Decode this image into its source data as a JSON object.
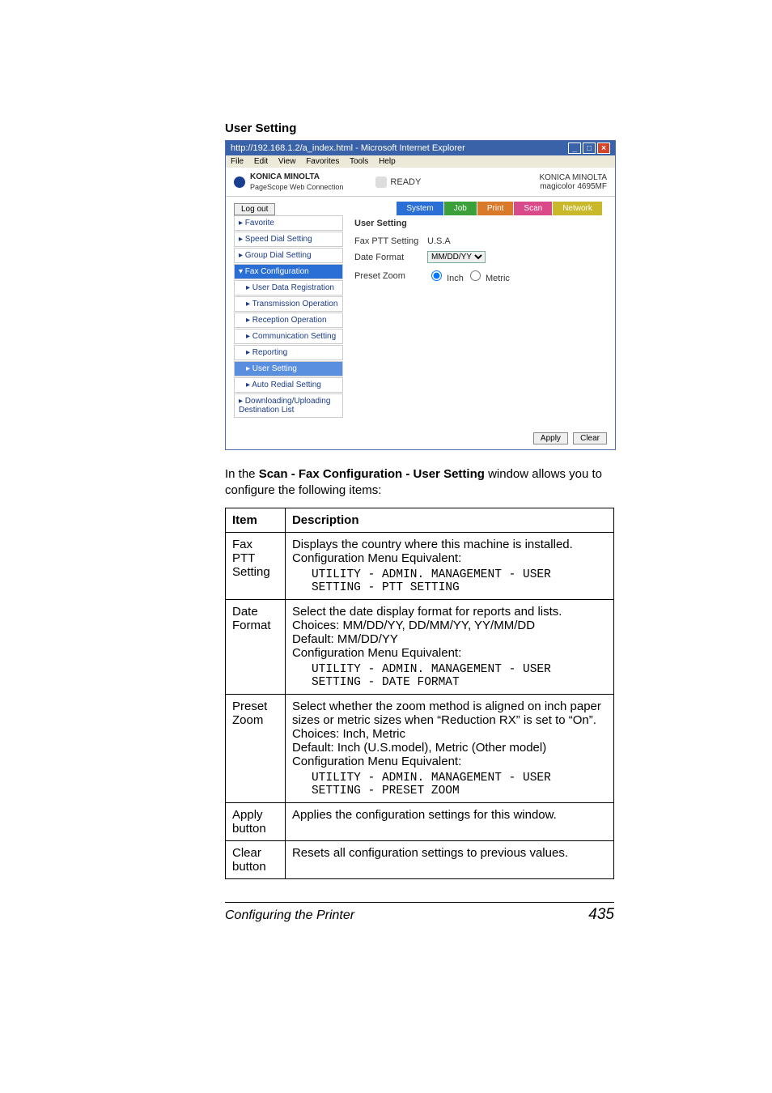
{
  "heading": "User Setting",
  "ie": {
    "title": "http://192.168.1.2/a_index.html - Microsoft Internet Explorer",
    "menus": [
      "File",
      "Edit",
      "View",
      "Favorites",
      "Tools",
      "Help"
    ],
    "win_min": "_",
    "win_max": "□",
    "win_close": "×"
  },
  "header": {
    "brand": "KONICA MINOLTA",
    "product": "PageScope Web Connection",
    "ready_label": "READY",
    "right1": "KONICA MINOLTA",
    "right2": "magicolor 4695MF"
  },
  "logout": "Log out",
  "tabs": {
    "system": "System",
    "job": "Job",
    "print": "Print",
    "scan": "Scan",
    "network": "Network"
  },
  "side": {
    "favorite": "▸ Favorite",
    "speed": "▸ Speed Dial Setting",
    "group": "▸ Group Dial Setting",
    "faxconf": "▾ Fax Configuration",
    "udr": "▸ User Data Registration",
    "txop": "▸ Transmission Operation",
    "rxop": "▸ Reception Operation",
    "comm": "▸ Communication Setting",
    "rep": "▸ Reporting",
    "user": "▸ User Setting",
    "auto": "▸ Auto Redial Setting",
    "dl": "▸ Downloading/Uploading Destination List"
  },
  "mainpanel": {
    "title": "User Setting",
    "r1l": "Fax PTT Setting",
    "r1v": "U.S.A",
    "r2l": "Date Format",
    "r2v": "MM/DD/YY",
    "r3l": "Preset Zoom",
    "r3a": "Inch",
    "r3b": "Metric",
    "apply": "Apply",
    "clear": "Clear"
  },
  "lead1": "In the ",
  "lead_b": "Scan - Fax Configuration - User Setting",
  "lead2": " window allows you to configure the following items:",
  "th_item": "Item",
  "th_desc": "Description",
  "rows": {
    "ptt": {
      "item": "Fax PTT Setting",
      "d1": "Displays the country where this machine is installed.",
      "d2": "Configuration Menu Equivalent:",
      "mono": "UTILITY - ADMIN. MANAGEMENT - USER\nSETTING - PTT SETTING"
    },
    "date": {
      "item": "Date Format",
      "d1": "Select the date display format for reports and lists.",
      "d2": "Choices: MM/DD/YY, DD/MM/YY, YY/MM/DD",
      "d3": "Default: MM/DD/YY",
      "d4": "Configuration Menu Equivalent:",
      "mono": "UTILITY - ADMIN. MANAGEMENT - USER\nSETTING - DATE FORMAT"
    },
    "zoom": {
      "item": "Preset Zoom",
      "d1": "Select whether the zoom method is aligned on inch paper sizes or metric sizes when “Reduction RX” is set to “On”.",
      "d2": "Choices: Inch, Metric",
      "d3": "Default: Inch (U.S.model), Metric (Other model)",
      "d4": "Configuration Menu Equivalent:",
      "mono": "UTILITY - ADMIN. MANAGEMENT - USER\nSETTING - PRESET ZOOM"
    },
    "apply": {
      "item": "Apply button",
      "d": "Applies the configuration settings for this window."
    },
    "clear": {
      "item": "Clear button",
      "d": "Resets all configuration settings to previous values."
    }
  },
  "footer_left": "Configuring the Printer",
  "footer_right": "435"
}
